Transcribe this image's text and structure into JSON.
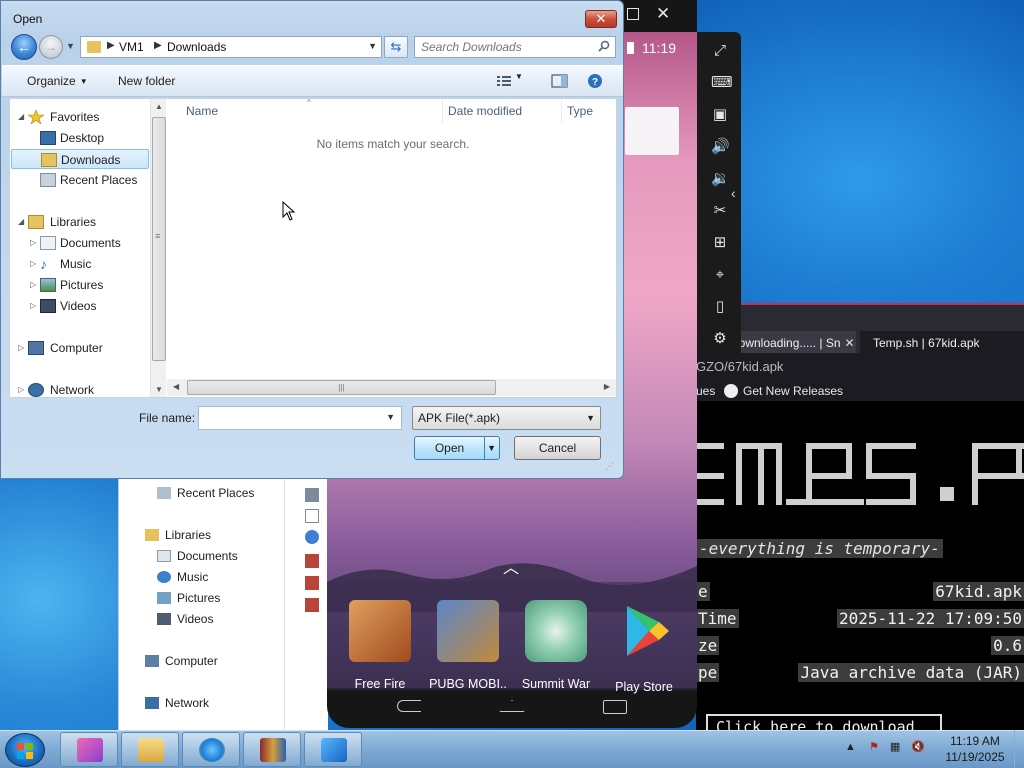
{
  "dialog": {
    "title": "Open",
    "close_glyph": "✕",
    "address": {
      "root": "VM1",
      "current": "Downloads"
    },
    "search_placeholder": "Search Downloads",
    "toolbar": {
      "organize": "Organize",
      "new_folder": "New folder"
    },
    "nav": {
      "favorites": "Favorites",
      "desktop": "Desktop",
      "downloads": "Downloads",
      "recent_places": "Recent Places",
      "libraries": "Libraries",
      "documents": "Documents",
      "music": "Music",
      "pictures": "Pictures",
      "videos": "Videos",
      "computer": "Computer",
      "network": "Network"
    },
    "columns": {
      "name": "Name",
      "date_modified": "Date modified",
      "type": "Type"
    },
    "empty_message": "No items match your search.",
    "file_name_label": "File name:",
    "file_name_value": "",
    "file_type": "APK File(*.apk)",
    "open_label": "Open",
    "cancel_label": "Cancel"
  },
  "emulator": {
    "time": "11:19",
    "apps": [
      {
        "label": "Free Fire",
        "color": "#c9772e"
      },
      {
        "label": "PUBG MOBI..",
        "color": "#2d5aa8"
      },
      {
        "label": "Summit War",
        "color": "#7fc0a3"
      },
      {
        "label": "Play Store",
        "color": "#34a853"
      }
    ]
  },
  "browser": {
    "tab1": "Downloading..... | Sn",
    "tab2": "Temp.sh | 67kid.apk",
    "url_tail": "GZO/67kid.apk",
    "bookmark_prefix": "ues",
    "bookmark": "Get New Releases",
    "tagline": "-everything is temporary-",
    "rows": [
      {
        "k": "e",
        "v": "67kid.apk"
      },
      {
        "k": "Time",
        "v": "2025-11-22 17:09:50"
      },
      {
        "k": "ze",
        "v": "0.6"
      },
      {
        "k": "pe",
        "v": "Java archive data (JAR)"
      }
    ],
    "download_button": "Click here to download"
  },
  "explorer": {
    "recent_places": "Recent Places",
    "libraries": "Libraries",
    "documents": "Documents",
    "music": "Music",
    "pictures": "Pictures",
    "videos": "Videos",
    "computer": "Computer",
    "network": "Network"
  },
  "taskbar": {
    "clock_time": "11:19 AM",
    "clock_date": "11/19/2025",
    "pinned": [
      "bluestacks-icon",
      "file-explorer-icon",
      "internet-explorer-icon",
      "winrar-icon",
      "swan-app-icon"
    ]
  }
}
